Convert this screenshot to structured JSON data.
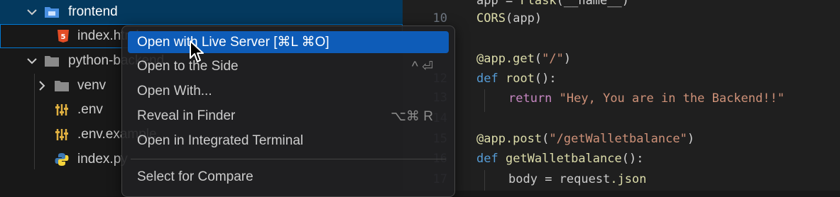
{
  "explorer": {
    "items": [
      {
        "label": "frontend",
        "icon": "folder-icon",
        "kind": "folder-open"
      },
      {
        "label": "index.html",
        "icon": "html-file-icon",
        "kind": "file"
      },
      {
        "label": "python-backend",
        "icon": "folder-icon",
        "kind": "folder-open"
      },
      {
        "label": "venv",
        "icon": "folder-icon",
        "kind": "folder-closed"
      },
      {
        "label": ".env",
        "icon": "settings-file-icon",
        "kind": "file"
      },
      {
        "label": ".env.example",
        "icon": "settings-file-icon",
        "kind": "file"
      },
      {
        "label": "index.py",
        "icon": "python-file-icon",
        "kind": "file"
      }
    ]
  },
  "context_menu": {
    "items": [
      {
        "label": "Open with Live Server [⌘L ⌘O]",
        "shortcut": ""
      },
      {
        "label": "Open to the Side",
        "shortcut": "^ ⏎"
      },
      {
        "label": "Open With...",
        "shortcut": ""
      },
      {
        "label": "Reveal in Finder",
        "shortcut": "⌥⌘ R"
      },
      {
        "label": "Open in Integrated Terminal",
        "shortcut": ""
      },
      {
        "label": "Select for Compare",
        "shortcut": ""
      }
    ]
  },
  "editor": {
    "line_numbers": [
      "10",
      "11",
      "12",
      "13",
      "14",
      "15",
      "16",
      "17",
      "18"
    ],
    "lines": {
      "l0": {
        "a": "app",
        "b": " = ",
        "c": "Flask",
        "d": "(__name__)"
      },
      "l1": {
        "a": "CORS",
        "b": "(",
        "c": "app",
        "d": ")"
      },
      "l3": {
        "a": "@app.get",
        "b": "(",
        "c": "\"/\"",
        "d": ")"
      },
      "l4": {
        "a": "def",
        "b": " ",
        "c": "root",
        "d": "():"
      },
      "l5": {
        "a": "return",
        "b": " ",
        "c": "\"Hey, You are in the Backend!!\"",
        "d": ""
      },
      "l7": {
        "a": "@app.post",
        "b": "(",
        "c": "\"/getWalletbalance\"",
        "d": ")"
      },
      "l8": {
        "a": "def",
        "b": " ",
        "c": "getWalletbalance",
        "d": "():"
      },
      "l9": {
        "a": "body",
        "b": " = ",
        "c": "request",
        "d": ".json"
      }
    }
  },
  "colors": {
    "accent": "#0e5cb8",
    "selection": "#04395e"
  }
}
